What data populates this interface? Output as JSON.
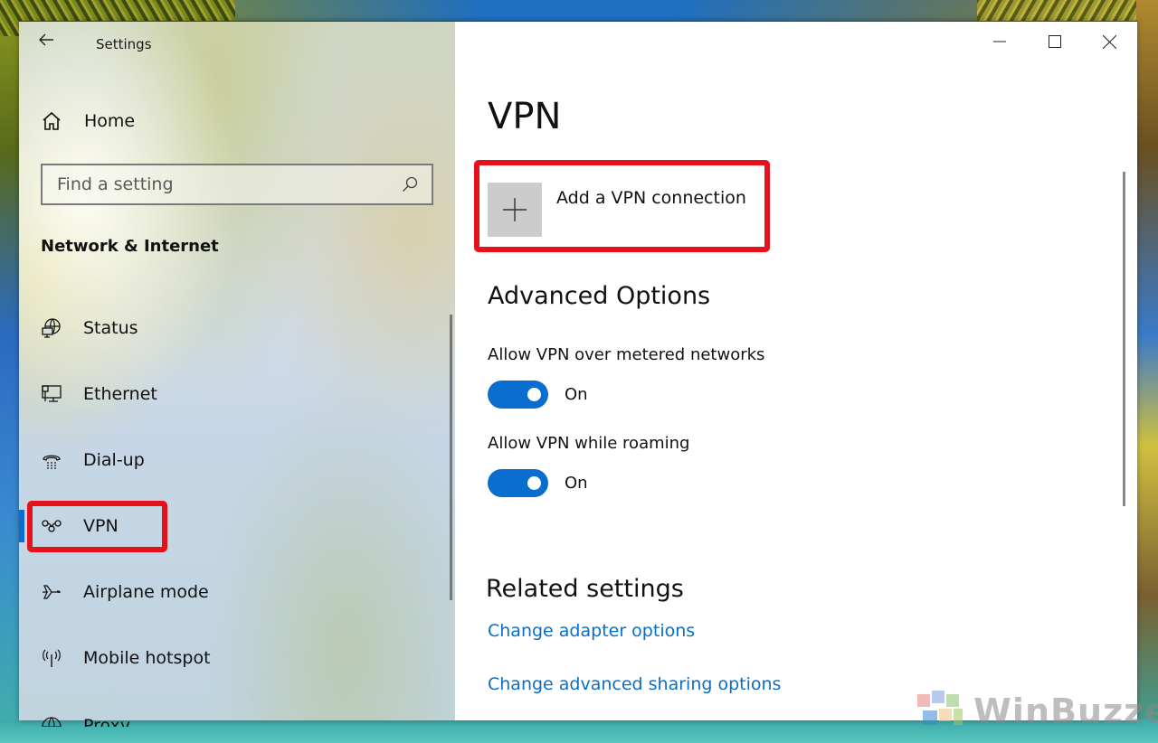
{
  "window": {
    "app_title": "Settings",
    "controls": {
      "minimize": "minimize-icon",
      "maximize": "maximize-icon",
      "close": "close-icon"
    }
  },
  "sidebar": {
    "back_icon": "arrow-left-icon",
    "home": {
      "icon": "home-icon",
      "label": "Home"
    },
    "search": {
      "placeholder": "Find a setting",
      "value": "",
      "icon": "search-icon"
    },
    "section_heading": "Network & Internet",
    "items": [
      {
        "label": "Status",
        "icon": "globe-monitor-icon",
        "active": false
      },
      {
        "label": "Ethernet",
        "icon": "ethernet-icon",
        "active": false
      },
      {
        "label": "Dial-up",
        "icon": "dialup-phone-icon",
        "active": false
      },
      {
        "label": "VPN",
        "icon": "vpn-icon",
        "active": true
      },
      {
        "label": "Airplane mode",
        "icon": "airplane-icon",
        "active": false
      },
      {
        "label": "Mobile hotspot",
        "icon": "hotspot-icon",
        "active": false
      },
      {
        "label": "Proxy",
        "icon": "globe-icon",
        "active": false
      }
    ]
  },
  "main": {
    "page_title": "VPN",
    "add_vpn": {
      "icon": "plus-icon",
      "label": "Add a VPN connection"
    },
    "advanced": {
      "heading": "Advanced Options",
      "options": [
        {
          "label": "Allow VPN over metered networks",
          "state": "On",
          "enabled": true
        },
        {
          "label": "Allow VPN while roaming",
          "state": "On",
          "enabled": true
        }
      ]
    },
    "related": {
      "heading": "Related settings",
      "links": [
        {
          "label": "Change adapter options"
        },
        {
          "label": "Change advanced sharing options"
        }
      ]
    }
  },
  "colors": {
    "accent": "#0a6ed1",
    "link": "#0a6ec8",
    "highlight": "#e8101a"
  },
  "watermark": {
    "text": "WinBuzzer"
  }
}
